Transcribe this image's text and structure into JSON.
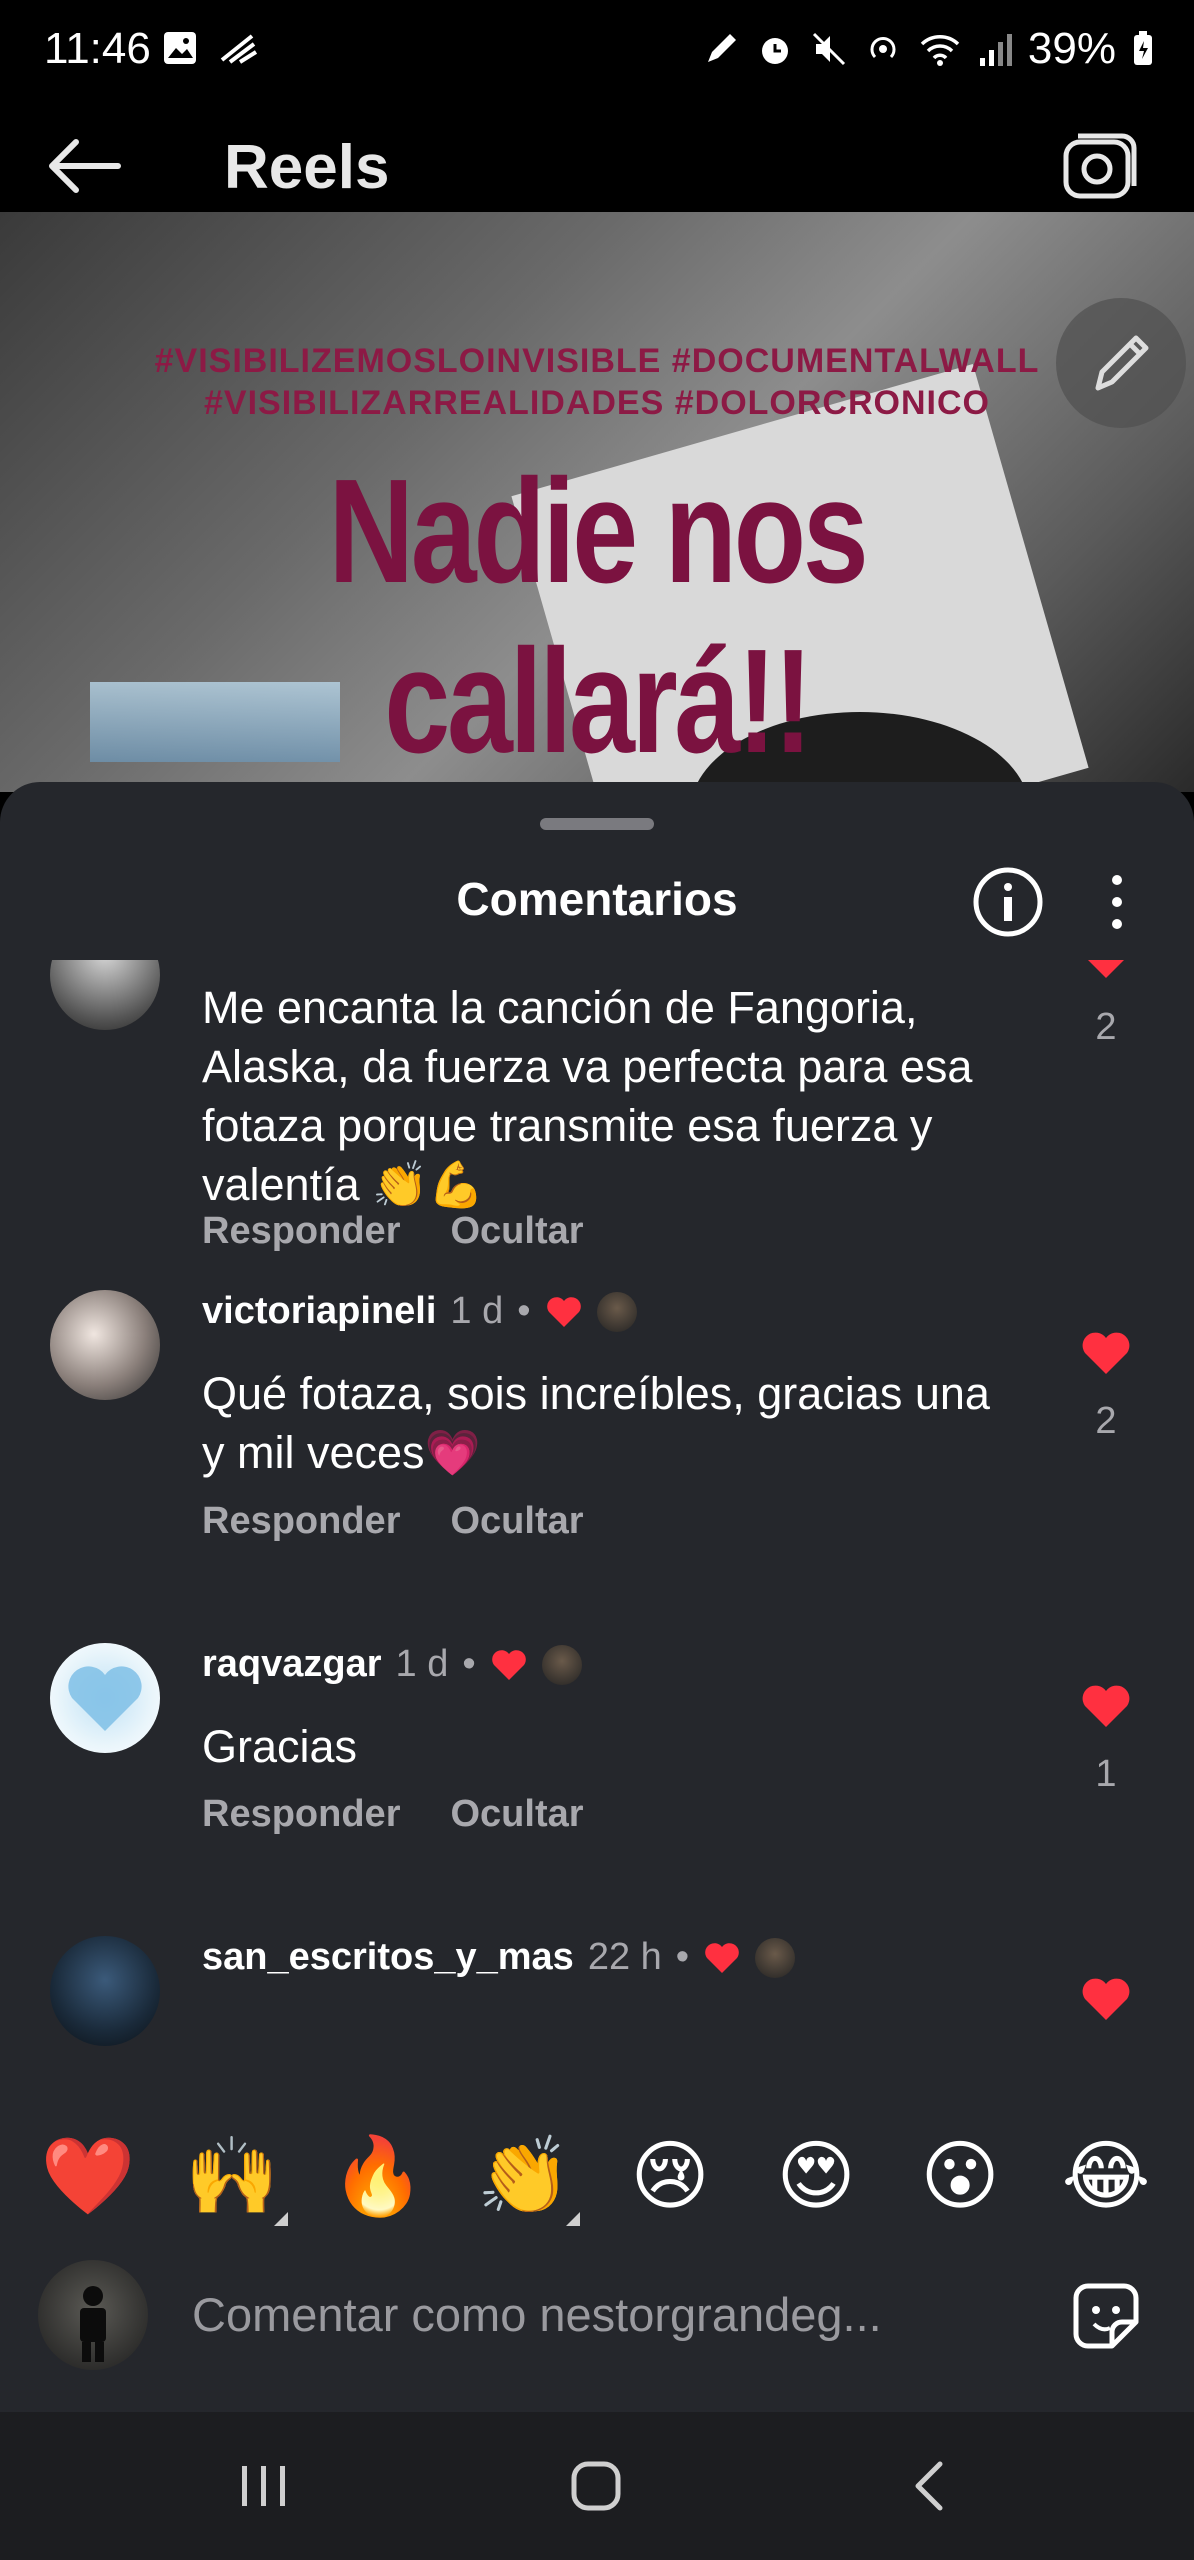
{
  "status_bar": {
    "time": "11:46",
    "battery": "39%"
  },
  "header": {
    "title": "Reels"
  },
  "video": {
    "hashtags_line1": "#VISIBILIZEMOSLOINVISIBLE #DOCUMENTALWALL",
    "hashtags_line2": "#VISIBILIZARREALIDADES #DOLORCRONICO",
    "headline": "Nadie nos callará!!"
  },
  "sheet": {
    "title": "Comentarios"
  },
  "comments": [
    {
      "username": "",
      "text": "Me encanta la canción de Fangoria, Alaska, da fuerza va perfecta para esa fotaza porque transmite esa fuerza y valentía 👏💪",
      "reply_label": "Responder",
      "hide_label": "Ocultar",
      "likes": "2"
    },
    {
      "username": "victoriapineli",
      "time": "1 d",
      "text": "Qué fotaza, sois increíbles, gracias una y mil veces💗",
      "reply_label": "Responder",
      "hide_label": "Ocultar",
      "likes": "2"
    },
    {
      "username": "raqvazgar",
      "time": "1 d",
      "text": "Gracias",
      "reply_label": "Responder",
      "hide_label": "Ocultar",
      "likes": "1"
    },
    {
      "username": "san_escritos_y_mas",
      "time": "22 h"
    }
  ],
  "emoji_bar": [
    "❤️",
    "🙌",
    "🔥",
    "👏",
    "😢",
    "😍",
    "😮",
    "😂"
  ],
  "comment_input": {
    "placeholder": "Comentar como nestorgrandeg..."
  },
  "colors": {
    "sheet_bg": "#25272c",
    "like_red": "#ff3040",
    "headline": "#7b1240"
  }
}
